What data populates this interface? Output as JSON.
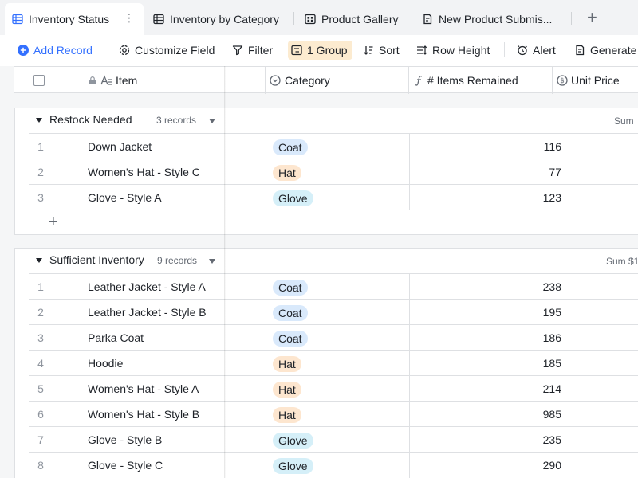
{
  "tabs": [
    {
      "label": "Inventory Status",
      "icon": "grid-view-icon",
      "active": true
    },
    {
      "label": "Inventory by Category",
      "icon": "grid-view-icon",
      "active": false
    },
    {
      "label": "Product Gallery",
      "icon": "gallery-view-icon",
      "active": false
    },
    {
      "label": "New Product Submis...",
      "icon": "form-view-icon",
      "active": false
    }
  ],
  "toolbar": {
    "add_record": "Add Record",
    "customize_field": "Customize Field",
    "filter": "Filter",
    "group": "1 Group",
    "sort": "Sort",
    "row_height": "Row Height",
    "alert": "Alert",
    "generate": "Generate"
  },
  "columns": {
    "item": "Item",
    "category": "Category",
    "items_remained": "# Items Remained",
    "unit_price": "Unit Price"
  },
  "category_colors": {
    "Coat": "#d9e9fb",
    "Hat": "#fde6cf",
    "Glove": "#d5eff8"
  },
  "groups": [
    {
      "title": "Restock Needed",
      "count": "3 records",
      "sum_label": "Sum",
      "rows": [
        {
          "n": "1",
          "item": "Down Jacket",
          "category": "Coat",
          "remained": "116"
        },
        {
          "n": "2",
          "item": "Women's Hat - Style C",
          "category": "Hat",
          "remained": "77"
        },
        {
          "n": "3",
          "item": "Glove - Style A",
          "category": "Glove",
          "remained": "123"
        }
      ]
    },
    {
      "title": "Sufficient Inventory",
      "count": "9 records",
      "sum_label": "Sum $1",
      "rows": [
        {
          "n": "1",
          "item": "Leather Jacket - Style A",
          "category": "Coat",
          "remained": "238"
        },
        {
          "n": "2",
          "item": "Leather Jacket - Style B",
          "category": "Coat",
          "remained": "195"
        },
        {
          "n": "3",
          "item": "Parka Coat",
          "category": "Coat",
          "remained": "186"
        },
        {
          "n": "4",
          "item": "Hoodie",
          "category": "Hat",
          "remained": "185"
        },
        {
          "n": "5",
          "item": "Women's Hat - Style A",
          "category": "Hat",
          "remained": "214"
        },
        {
          "n": "6",
          "item": "Women's Hat - Style B",
          "category": "Hat",
          "remained": "985"
        },
        {
          "n": "7",
          "item": "Glove - Style B",
          "category": "Glove",
          "remained": "235"
        },
        {
          "n": "8",
          "item": "Glove - Style C",
          "category": "Glove",
          "remained": "290"
        }
      ]
    }
  ]
}
